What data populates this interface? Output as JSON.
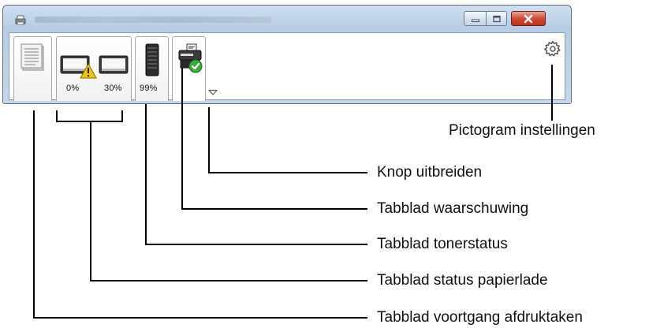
{
  "window": {
    "controls": {
      "minimize": "minimize-icon",
      "maximize": "maximize-icon",
      "close": "close-icon"
    }
  },
  "tabs": [
    {
      "name": "tab-print-progress",
      "icon": "document-stack-icon"
    },
    {
      "name": "tab-paper-tray-status",
      "icon": "paper-tray-icon",
      "labels": [
        "0%",
        "30%"
      ],
      "warning_icon": "warning-icon"
    },
    {
      "name": "tab-toner-status",
      "icon": "toner-cartridge-icon",
      "labels": [
        "99%"
      ]
    },
    {
      "name": "tab-alert",
      "icon": "printer-ok-icon"
    }
  ],
  "expand_button": {
    "icon": "chevron-down-icon"
  },
  "settings": {
    "icon": "gear-icon"
  },
  "callouts": {
    "settings_icon": "Pictogram instellingen",
    "expand_button": "Knop uitbreiden",
    "alert_tab": "Tabblad waarschuwing",
    "toner_tab": "Tabblad tonerstatus",
    "paper_tab": "Tabblad status papierlade",
    "print_tab": "Tabblad voortgang afdruktaken"
  },
  "colors": {
    "close_button": "#d04b33",
    "warning": "#f5c400",
    "ok_check": "#3cab3c"
  }
}
